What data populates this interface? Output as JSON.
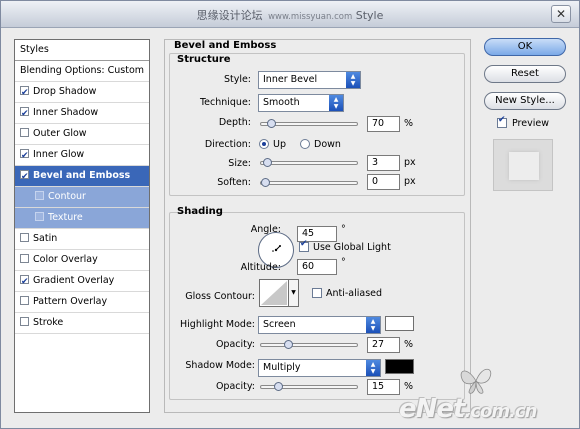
{
  "titlebar": {
    "title": "思缘设计论坛",
    "site": "www.missyuan.com",
    "title_suffix": "Style",
    "close_icon": "close-icon"
  },
  "left_panel": {
    "header": "Styles",
    "items": [
      {
        "label": "Blending Options: Custom",
        "checkbox": false,
        "checked": false
      },
      {
        "label": "Drop Shadow",
        "checkbox": true,
        "checked": true
      },
      {
        "label": "Inner Shadow",
        "checkbox": true,
        "checked": true
      },
      {
        "label": "Outer Glow",
        "checkbox": true,
        "checked": false
      },
      {
        "label": "Inner Glow",
        "checkbox": true,
        "checked": true
      },
      {
        "label": "Bevel and Emboss",
        "checkbox": true,
        "checked": true,
        "selected": true
      },
      {
        "label": "Contour",
        "checkbox": true,
        "checked": false,
        "sub": true
      },
      {
        "label": "Texture",
        "checkbox": true,
        "checked": false,
        "sub": true
      },
      {
        "label": "Satin",
        "checkbox": true,
        "checked": false
      },
      {
        "label": "Color Overlay",
        "checkbox": true,
        "checked": false
      },
      {
        "label": "Gradient Overlay",
        "checkbox": true,
        "checked": true
      },
      {
        "label": "Pattern Overlay",
        "checkbox": true,
        "checked": false
      },
      {
        "label": "Stroke",
        "checkbox": true,
        "checked": false
      }
    ]
  },
  "bevel": {
    "title": "Bevel and Emboss",
    "structure": {
      "title": "Structure",
      "style_label": "Style:",
      "style_value": "Inner Bevel",
      "technique_label": "Technique:",
      "technique_value": "Smooth",
      "depth_label": "Depth:",
      "depth_value": "70",
      "depth_unit": "%",
      "depth_level": 0.07,
      "direction_label": "Direction:",
      "dir_up": "Up",
      "dir_down": "Down",
      "direction_selected": "Up",
      "size_label": "Size:",
      "size_value": "3",
      "size_unit": "px",
      "size_level": 0.02,
      "soften_label": "Soften:",
      "soften_value": "0",
      "soften_unit": "px",
      "soften_level": 0.0
    },
    "shading": {
      "title": "Shading",
      "angle_label": "Angle:",
      "angle_value": "45",
      "angle_unit": "°",
      "global_light_label": "Use Global Light",
      "global_light_checked": true,
      "altitude_label": "Altitude:",
      "altitude_value": "60",
      "altitude_unit": "°",
      "gloss_label": "Gloss Contour:",
      "anti_aliased_label": "Anti-aliased",
      "anti_aliased_checked": false,
      "highlight_mode_label": "Highlight Mode:",
      "highlight_mode_value": "Screen",
      "highlight_color": "#ffffff",
      "highlight_opacity_label": "Opacity:",
      "highlight_opacity_value": "27",
      "highlight_opacity_unit": "%",
      "highlight_opacity_level": 0.27,
      "shadow_mode_label": "Shadow Mode:",
      "shadow_mode_value": "Multiply",
      "shadow_color": "#000000",
      "shadow_opacity_label": "Opacity:",
      "shadow_opacity_value": "15",
      "shadow_opacity_unit": "%",
      "shadow_opacity_level": 0.15
    }
  },
  "buttons": {
    "ok": "OK",
    "reset": "Reset",
    "new_style": "New Style...",
    "preview_label": "Preview",
    "preview_checked": true
  },
  "watermark": {
    "text_main": "eNet",
    "text_small": ".com.cn"
  },
  "colors": {
    "selected": "#3a67b8",
    "sub_item": "#8aa6d8",
    "accent_blue": "#1b50b8"
  }
}
